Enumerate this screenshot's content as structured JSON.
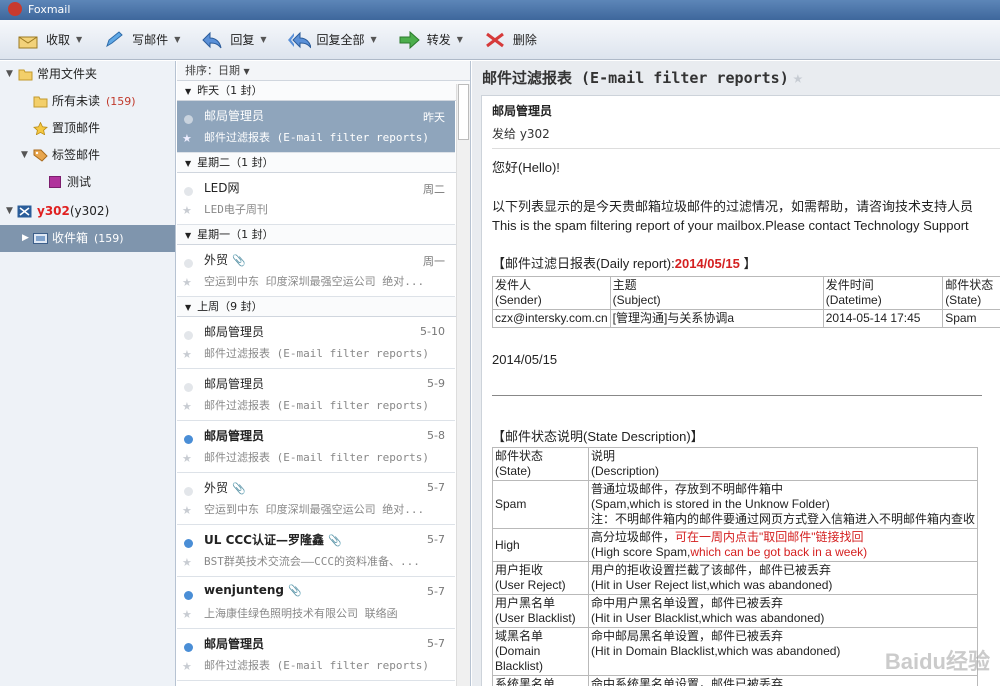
{
  "app": {
    "title": "Foxmail"
  },
  "toolbar": [
    {
      "label": "收取",
      "icon": "receive-icon",
      "dd": true
    },
    {
      "label": "写邮件",
      "icon": "compose-icon",
      "dd": true
    },
    {
      "label": "回复",
      "icon": "reply-icon",
      "dd": true
    },
    {
      "label": "回复全部",
      "icon": "reply-all-icon",
      "dd": true
    },
    {
      "label": "转发",
      "icon": "forward-icon",
      "dd": true
    },
    {
      "label": "删除",
      "icon": "delete-icon",
      "dd": false
    }
  ],
  "sidebar": {
    "common": "常用文件夹",
    "unread": "所有未读",
    "unread_count": "(159)",
    "pinned": "置顶邮件",
    "tagged": "标签邮件",
    "test": "测试",
    "account": "y302",
    "account_suffix": "(y302)",
    "inbox": "收件箱",
    "inbox_count": "(159)"
  },
  "list": {
    "sort": "排序：日期",
    "groups": [
      {
        "label": "昨天（1 封）",
        "mails": [
          {
            "from": "邮局管理员",
            "date": "昨天",
            "subject": "邮件过滤报表 (E-mail filter reports)",
            "bold": false,
            "unread": false,
            "clip": false,
            "selected": true
          }
        ]
      },
      {
        "label": "星期二（1 封）",
        "mails": [
          {
            "from": "LED网",
            "date": "周二",
            "subject": "LED电子周刊",
            "bold": false,
            "unread": false,
            "clip": false,
            "selected": false
          }
        ]
      },
      {
        "label": "星期一（1 封）",
        "mails": [
          {
            "from": "外贸",
            "date": "周一",
            "subject": "空运到中东 印度深圳最强空运公司 绝对...",
            "bold": false,
            "unread": false,
            "clip": true,
            "selected": false
          }
        ]
      },
      {
        "label": "上周（9 封）",
        "mails": [
          {
            "from": "邮局管理员",
            "date": "5-10",
            "subject": "邮件过滤报表 (E-mail filter reports)",
            "bold": false,
            "unread": false,
            "clip": false,
            "selected": false
          },
          {
            "from": "邮局管理员",
            "date": "5-9",
            "subject": "邮件过滤报表 (E-mail filter reports)",
            "bold": false,
            "unread": false,
            "clip": false,
            "selected": false
          },
          {
            "from": "邮局管理员",
            "date": "5-8",
            "subject": "邮件过滤报表 (E-mail filter reports)",
            "bold": true,
            "unread": true,
            "clip": false,
            "selected": false
          },
          {
            "from": "外贸",
            "date": "5-7",
            "subject": "空运到中东 印度深圳最强空运公司 绝对...",
            "bold": false,
            "unread": false,
            "clip": true,
            "selected": false
          },
          {
            "from": "UL CCC认证—罗隆鑫",
            "date": "5-7",
            "subject": "BST群英技术交流会——CCC的资料准备、...",
            "bold": true,
            "unread": true,
            "clip": true,
            "selected": false
          },
          {
            "from": "wenjunteng",
            "date": "5-7",
            "subject": "上海康佳绿色照明技术有限公司 联络函",
            "bold": true,
            "unread": true,
            "clip": true,
            "selected": false
          },
          {
            "from": "邮局管理员",
            "date": "5-7",
            "subject": "邮件过滤报表 (E-mail filter reports)",
            "bold": true,
            "unread": true,
            "clip": false,
            "selected": false
          }
        ]
      }
    ]
  },
  "reader": {
    "title": "邮件过滤报表 (E-mail filter reports)",
    "from": "邮局管理员",
    "to": "发给 y302",
    "greeting": "您好(Hello)!",
    "intro_cn": "以下列表显示的是今天贵邮箱垃圾邮件的过滤情况，如需帮助，请咨询技术支持人员",
    "intro_en": "This is the spam filtering report of your mailbox.Please contact Technology Support",
    "daily_title": "【邮件过滤日报表(Daily report):",
    "daily_date": "2014/05/15",
    "daily_close": " 】",
    "daily_headers": [
      [
        "发件人",
        "(Sender)"
      ],
      [
        "主题",
        "(Subject)"
      ],
      [
        "发件时间",
        "(Datetime)"
      ],
      [
        "邮件状态",
        "(State)"
      ]
    ],
    "daily_rows": [
      [
        "czx@intersky.com.cn",
        "[管理沟通]与关系协调a",
        "2014-05-14 17:45",
        "Spam"
      ]
    ],
    "date_line": "2014/05/15",
    "state_title": "【邮件状态说明(State Description)】",
    "state_headers": [
      [
        "邮件状态",
        "(State)"
      ],
      [
        "说明",
        "(Description)"
      ]
    ],
    "state_rows": [
      {
        "state": [
          "Spam"
        ],
        "desc": [
          "普通垃圾邮件，存放到不明邮件箱中",
          "(Spam,which is stored in the Unknow Folder)",
          "注：不明邮件箱内的邮件要通过网页方式登入信箱进入不明邮件箱内查收"
        ]
      },
      {
        "state": [
          "High"
        ],
        "desc": [
          "高分垃圾邮件，",
          "可在一周内点击\"取回邮件\"链接找回",
          "(High score Spam,",
          "which can be got back in a week)"
        ],
        "red": true
      },
      {
        "state": [
          "用户拒收",
          "(User Reject)"
        ],
        "desc": [
          "用户的拒收设置拦截了该邮件，邮件已被丢弃",
          "(Hit in User Reject list,which was abandoned)"
        ]
      },
      {
        "state": [
          "用户黑名单",
          "(User Blacklist)"
        ],
        "desc": [
          "命中用户黑名单设置，邮件已被丢弃",
          "(Hit in User Blacklist,which was abandoned)"
        ]
      },
      {
        "state": [
          "域黑名单",
          "(Domain Blacklist)"
        ],
        "desc": [
          "命中邮局黑名单设置，邮件已被丢弃",
          "(Hit in Domain Blacklist,which was abandoned)"
        ]
      },
      {
        "state": [
          "系统黑名单",
          ""
        ],
        "desc": [
          "命中系统黑名单设置，邮件已被丢弃",
          ""
        ]
      }
    ],
    "watermark": "Baidu经验"
  }
}
